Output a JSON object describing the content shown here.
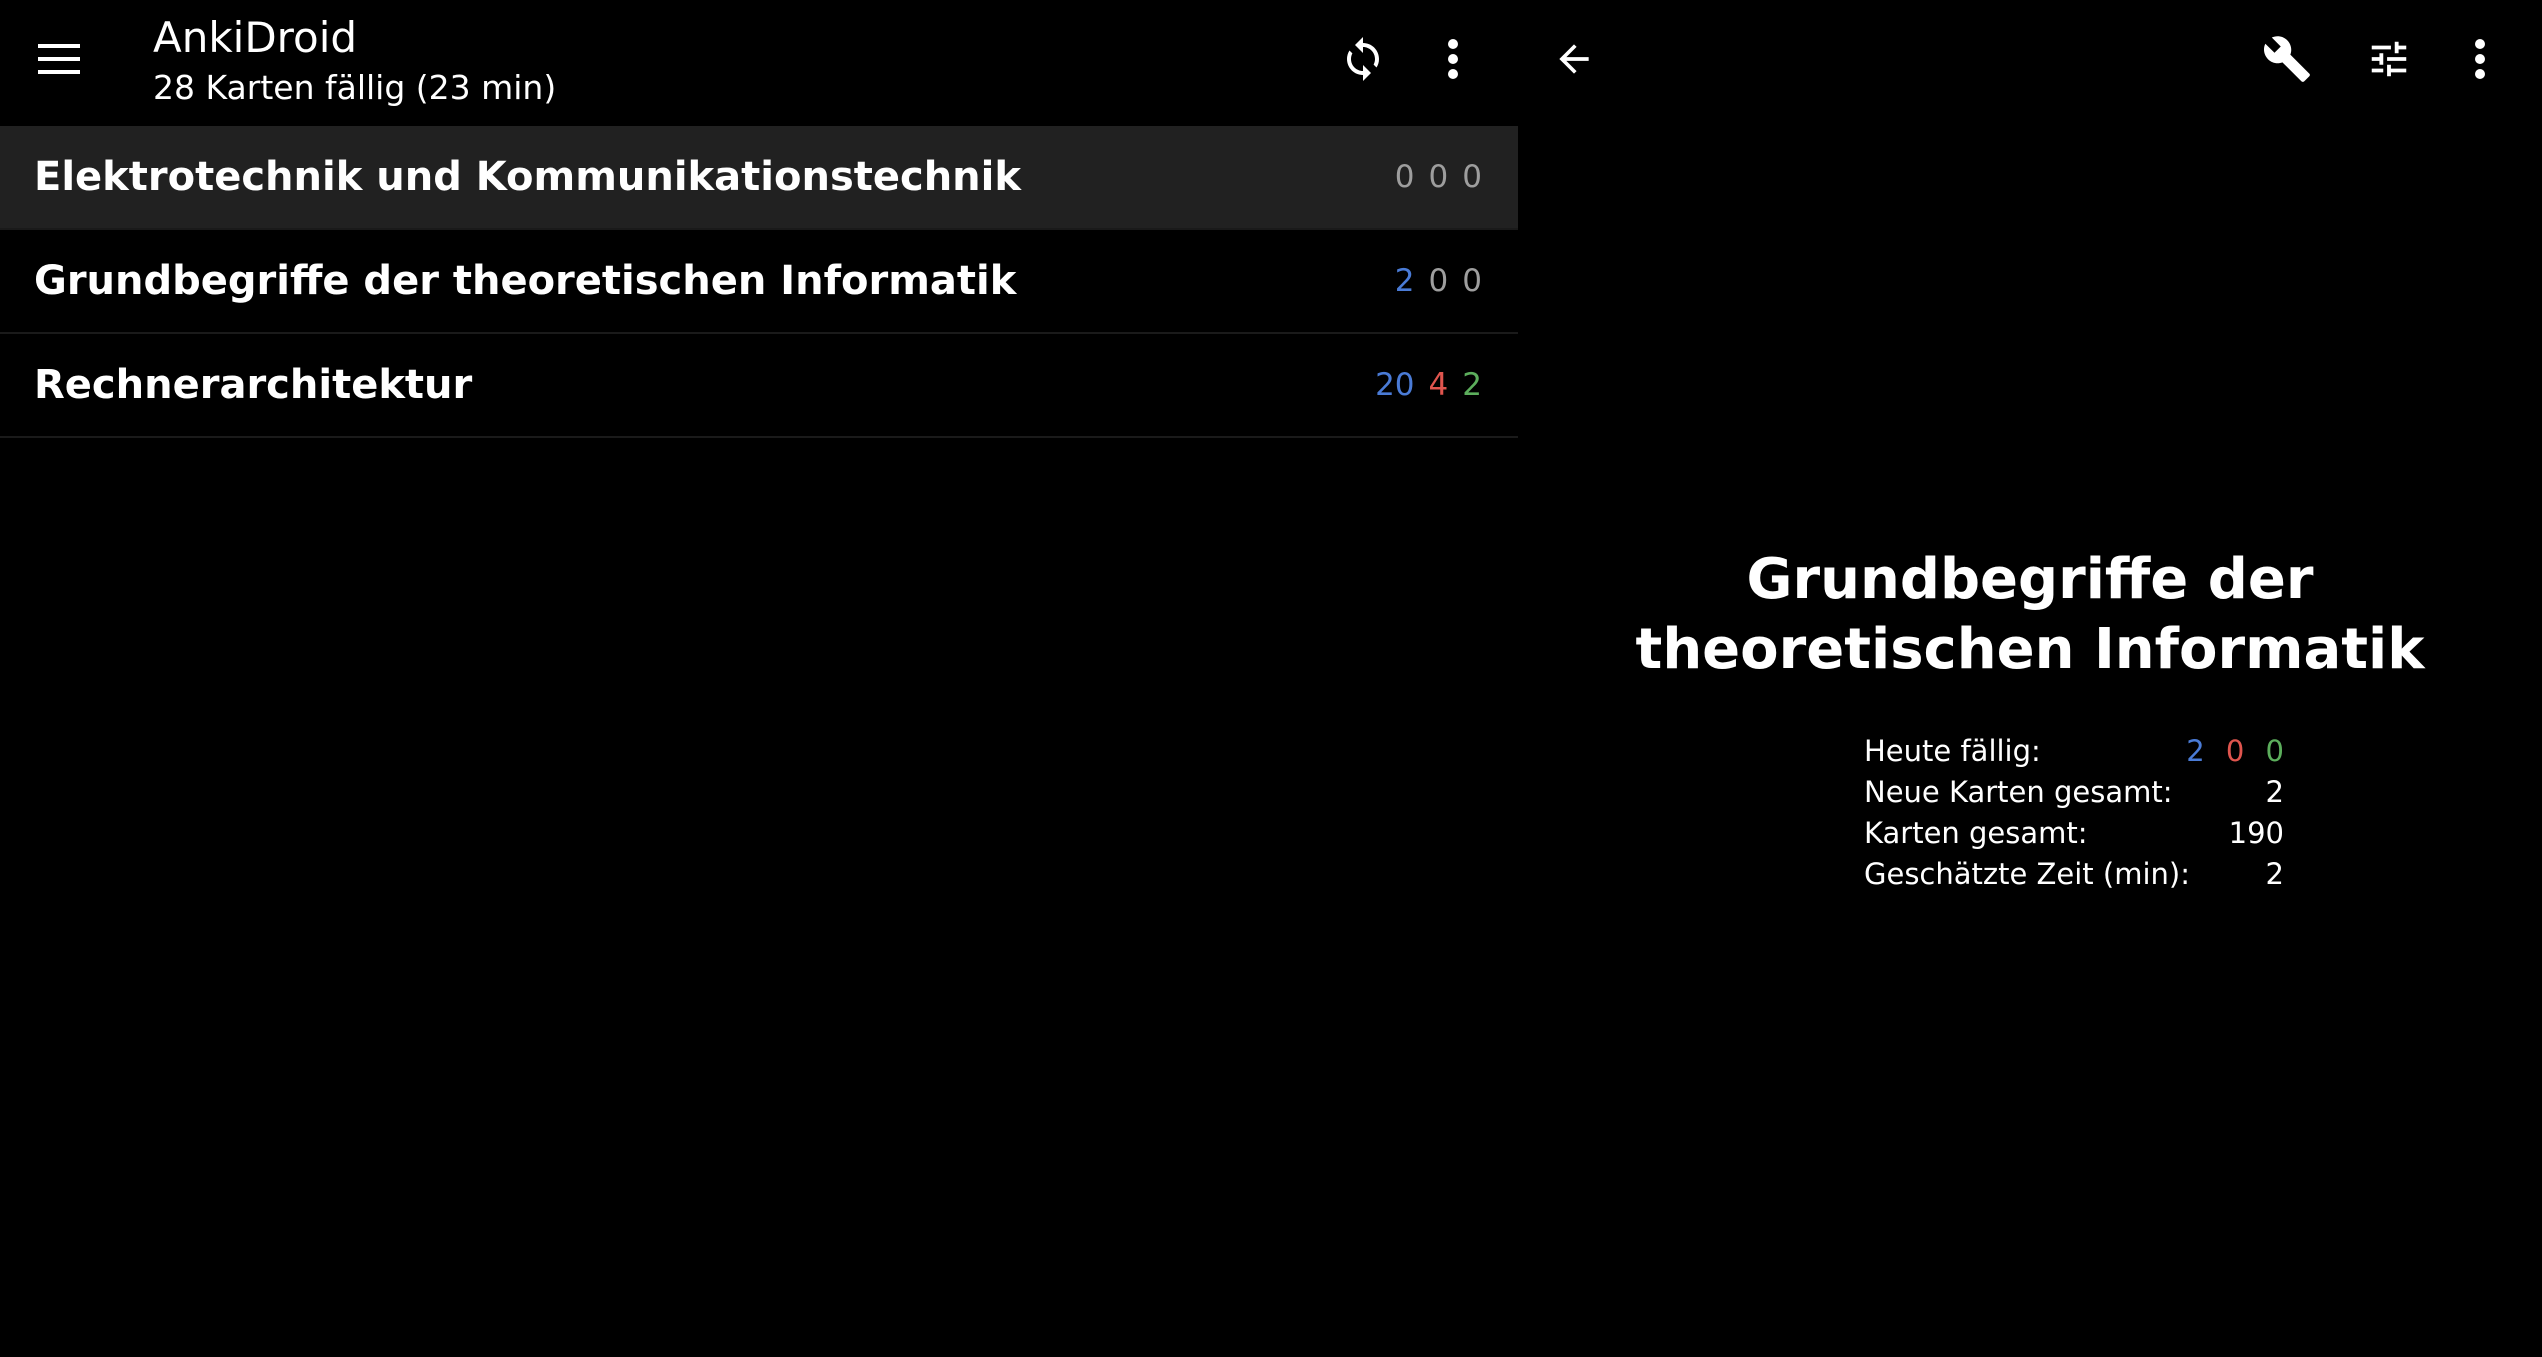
{
  "app": {
    "title": "AnkiDroid",
    "subtitle": "28 Karten fällig (23 min)"
  },
  "colors": {
    "new": "#4a7bd6",
    "learn": "#e0554e",
    "review": "#5cae5c",
    "zero": "#9e9e9e",
    "selected_row": "#212121"
  },
  "left_toolbar": {
    "icons": [
      "menu-icon",
      "sync-icon",
      "more-vert-icon"
    ]
  },
  "right_toolbar": {
    "icons": [
      "back-arrow-icon",
      "wrench-icon",
      "tune-icon",
      "more-vert-icon"
    ]
  },
  "decks": [
    {
      "name": "Elektrotechnik und Kommunikationstechnik",
      "new": "0",
      "learn": "0",
      "review": "0",
      "selected": true
    },
    {
      "name": "Grundbegriffe der theoretischen Informatik",
      "new": "2",
      "learn": "0",
      "review": "0",
      "selected": false
    },
    {
      "name": "Rechnerarchitektur",
      "new": "20",
      "learn": "4",
      "review": "2",
      "selected": false
    }
  ],
  "overview": {
    "title": "Grundbegriffe der theoretischen Informatik",
    "stats": {
      "due_today_label": "Heute fällig:",
      "due_today_new": "2",
      "due_today_learn": "0",
      "due_today_review": "0",
      "new_total_label": "Neue Karten gesamt:",
      "new_total_value": "2",
      "cards_total_label": "Karten gesamt:",
      "cards_total_value": "190",
      "est_time_label": "Geschätzte Zeit (min):",
      "est_time_value": "2"
    }
  }
}
